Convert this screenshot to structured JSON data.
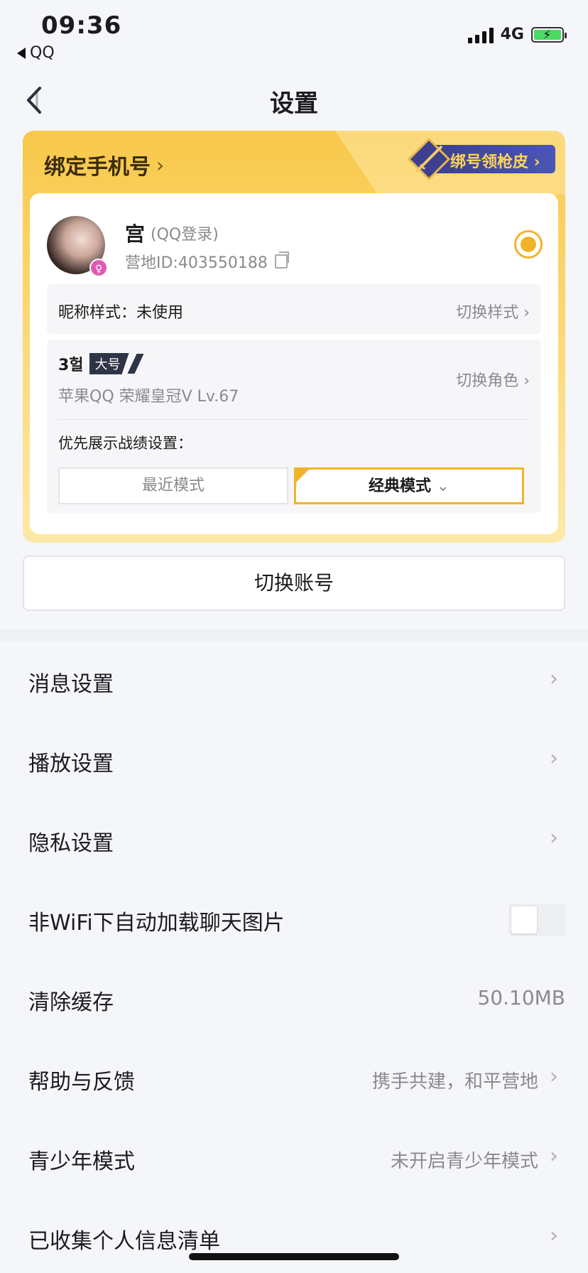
{
  "status_bar": {
    "time": "09:36",
    "back_app": "QQ",
    "network": "4G"
  },
  "nav": {
    "title": "设置",
    "back_icon": "back-arrow-icon"
  },
  "account_card": {
    "bind_phone_label": "绑定手机号",
    "promo_text": "绑号领枪皮",
    "user": {
      "name": "宫",
      "login_method": "(QQ登录)",
      "camp_id": "营地ID:403550188"
    },
    "nickname_style": {
      "label": "昵称样式：未使用",
      "action": "切换样式"
    },
    "role": {
      "name": "3헐",
      "tag": "大号",
      "info": "苹果QQ  荣耀皇冠V  Lv.67",
      "action": "切换角色"
    },
    "record_pref": {
      "label": "优先展示战绩设置：",
      "recent_mode": "最近模式",
      "classic_mode": "经典模式"
    },
    "colors": {
      "accent": "#f0b42a",
      "card_gradient_top": "#f8c84a"
    }
  },
  "switch_account": "切换账号",
  "settings": [
    {
      "label": "消息设置",
      "type": "nav"
    },
    {
      "label": "播放设置",
      "type": "nav"
    },
    {
      "label": "隐私设置",
      "type": "nav"
    },
    {
      "label": "非WiFi下自动加载聊天图片",
      "type": "toggle",
      "on": false
    },
    {
      "label": "清除缓存",
      "type": "value",
      "value": "50.10MB"
    },
    {
      "label": "帮助与反馈",
      "type": "nav",
      "detail": "携手共建，和平营地"
    },
    {
      "label": "青少年模式",
      "type": "nav",
      "detail": "未开启青少年模式"
    },
    {
      "label": "已收集个人信息清单",
      "type": "nav"
    }
  ]
}
